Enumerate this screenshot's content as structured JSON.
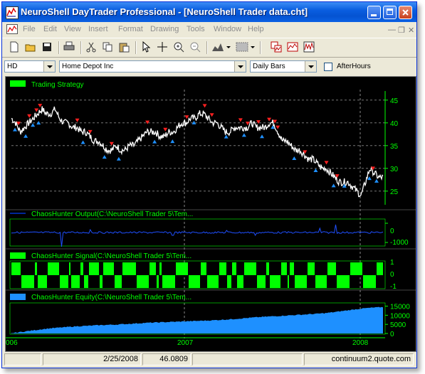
{
  "window": {
    "title": "NeuroShell DayTrader Professional - [NeuroShell Trader data.cht]"
  },
  "menu": [
    "File",
    "Edit",
    "View",
    "Insert",
    "Format",
    "Drawing",
    "Tools",
    "Window",
    "Help"
  ],
  "toolbar": {
    "icons": [
      "new-icon",
      "open-icon",
      "save-icon",
      "print-icon",
      "cut-icon",
      "copy-icon",
      "paste-icon",
      "pointer-icon",
      "crosshair-icon",
      "zoom-in-icon",
      "zoom-out-icon",
      "chart-type-icon",
      "fill-pattern-icon",
      "indicator-icon",
      "optimize-icon",
      "data-series-icon"
    ]
  },
  "selectors": {
    "symbol": "HD",
    "company": "Home Depot Inc",
    "period": "Daily Bars",
    "afterhours_label": "AfterHours",
    "afterhours_checked": false
  },
  "panes": [
    {
      "label": "Trading Strategy",
      "legend_color": "#00ff00"
    },
    {
      "label": "ChaosHunter Output(C:\\NeuroShell Trader 5\\Tem...",
      "legend_color": "#0033cc"
    },
    {
      "label": "ChaosHunter Signal(C:\\NeuroShell Trader 5\\Tem...",
      "legend_color": "#00ff00"
    },
    {
      "label": "ChaosHunter Equity(C:\\NeuroShell Trader 5\\Tem...",
      "legend_color": "#1e90ff"
    }
  ],
  "colors": {
    "chart_bg": "#000000",
    "price": "#ffffff",
    "buy": "#1e90ff",
    "sell": "#ff2020",
    "signal": "#00ff00",
    "equity": "#1e90ff",
    "axis_text": "#00ff00"
  },
  "statusbar": {
    "date": "2/25/2008",
    "value": "46.0809",
    "server": "continuum2.quote.com"
  },
  "chart_data": [
    {
      "type": "line",
      "title": "Trading Strategy",
      "y_ticks": [
        25,
        30,
        35,
        40,
        45
      ],
      "ylim": [
        22,
        47
      ],
      "x_tick_labels": [
        "006",
        "2007",
        "2008"
      ],
      "price_path": [
        41,
        40,
        38,
        39,
        40,
        41,
        42,
        43,
        42,
        42,
        43,
        41,
        40,
        40,
        39,
        39,
        38,
        38,
        37,
        36,
        36,
        35,
        34,
        34,
        35,
        34,
        34,
        35,
        35,
        36,
        37,
        38,
        38,
        38,
        37,
        37,
        38,
        38,
        39,
        40,
        40,
        41,
        41,
        42,
        42,
        41,
        40,
        40,
        39,
        38,
        38,
        39,
        39,
        39,
        39,
        40,
        39,
        39,
        39,
        40,
        40,
        38,
        36,
        36,
        35,
        34,
        34,
        33,
        32,
        32,
        31,
        30,
        30,
        29,
        28,
        27,
        27,
        27,
        26,
        25,
        24,
        27,
        30,
        29,
        28,
        28
      ],
      "sell_markers": 22,
      "buy_markers": 20
    },
    {
      "type": "line",
      "title": "ChaosHunter Output",
      "y_ticks": [
        0,
        -1000
      ]
    },
    {
      "type": "area",
      "title": "ChaosHunter Signal",
      "y_ticks": [
        1,
        0,
        -1
      ]
    },
    {
      "type": "area",
      "title": "ChaosHunter Equity",
      "y_ticks": [
        15000,
        10000,
        5000,
        0
      ],
      "ylim": [
        0,
        16000
      ],
      "equity_path": [
        200,
        800,
        1500,
        2200,
        2800,
        3200,
        3600,
        4000,
        4200,
        4500,
        4700,
        4900,
        5200,
        5500,
        5800,
        6000,
        6200,
        6400,
        6600,
        6800,
        7000,
        7200,
        7500,
        7800,
        8200,
        8600,
        9000,
        9300,
        9600,
        9900,
        10200,
        10500,
        10800,
        11200,
        11800,
        12500,
        13200,
        13800,
        14200,
        14500
      ]
    }
  ]
}
